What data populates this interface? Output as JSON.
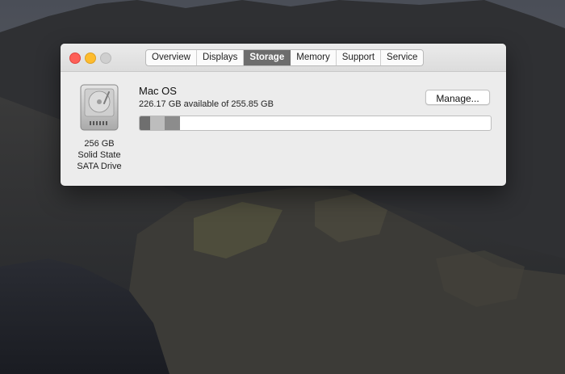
{
  "window": {
    "tabs": [
      "Overview",
      "Displays",
      "Storage",
      "Memory",
      "Support",
      "Service"
    ],
    "active_tab_index": 2
  },
  "disk": {
    "capacity_label": "256 GB",
    "type_label": "Solid State",
    "interface_label": "SATA Drive"
  },
  "volume": {
    "name": "Mac OS",
    "availability": "226.17 GB available of 255.85 GB"
  },
  "manage_button": {
    "label": "Manage..."
  },
  "storage_usage": {
    "used_fraction": 0.116,
    "segments": [
      {
        "fraction": 0.029,
        "color": "#6f6f6f"
      },
      {
        "fraction": 0.043,
        "color": "#bdbdbd"
      },
      {
        "fraction": 0.044,
        "color": "#8c8c8c"
      }
    ]
  },
  "colors": {
    "close": "#fe5f57",
    "minimize": "#febc2e",
    "zoom_disabled": "#cfcfcf",
    "active_tab": "#6d6d6d"
  }
}
